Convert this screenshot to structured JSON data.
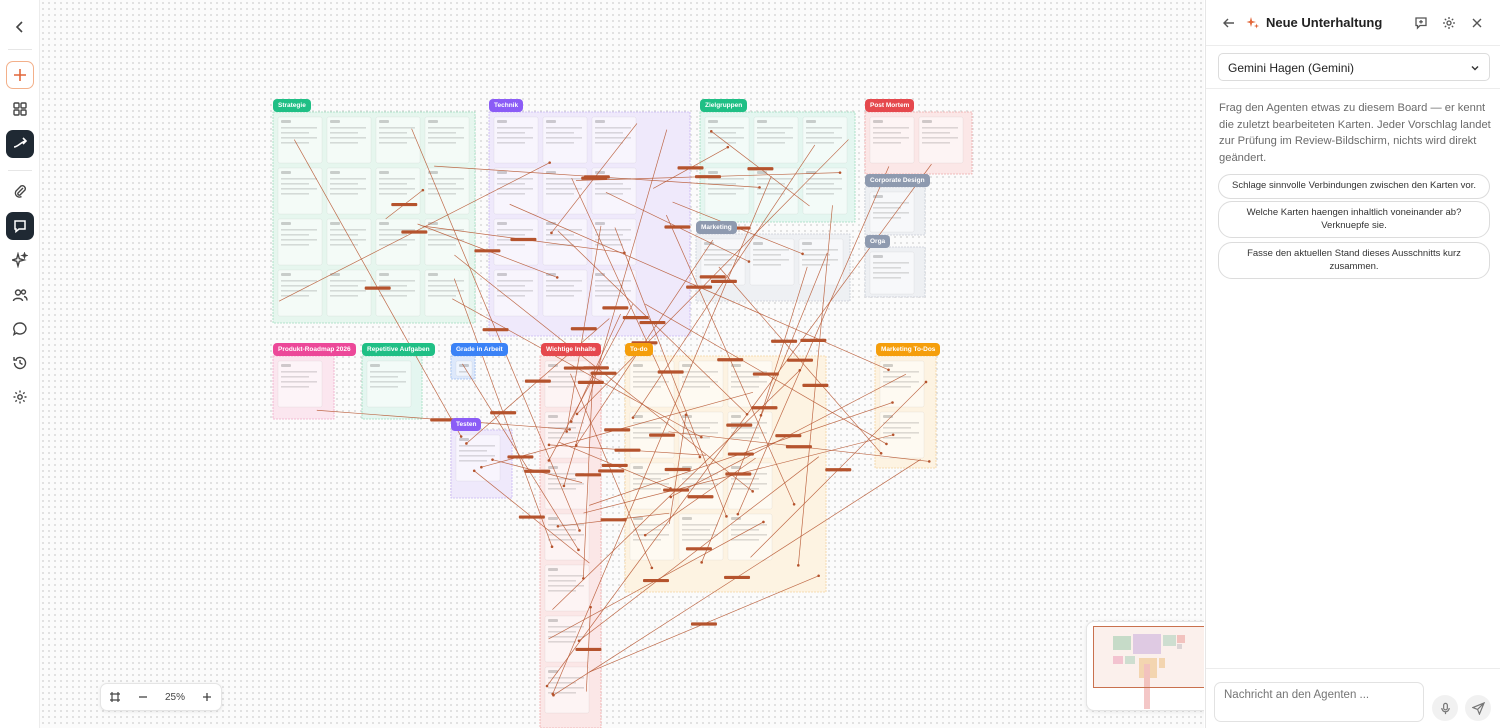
{
  "toolbar": {
    "items": [
      {
        "icon": "chevron-left-icon"
      },
      {
        "icon": "plus-icon"
      },
      {
        "icon": "grid-icon"
      },
      {
        "icon": "connector-icon"
      },
      {
        "icon": "paperclip-icon"
      },
      {
        "icon": "chat-square-icon"
      },
      {
        "icon": "sparkle-icon"
      },
      {
        "icon": "users-icon"
      },
      {
        "icon": "chat-bubble-icon"
      },
      {
        "icon": "history-icon"
      },
      {
        "icon": "gear-icon"
      }
    ]
  },
  "board": {
    "groups": [
      {
        "label": "Strategie",
        "color": "#1fbf85"
      },
      {
        "label": "Technik",
        "color": "#8b5cf6"
      },
      {
        "label": "Zielgruppen",
        "color": "#1fbf85"
      },
      {
        "label": "Post Mortem",
        "color": "#e5484d"
      },
      {
        "label": "Corporate Design",
        "color": "#8e9aaf"
      },
      {
        "label": "Marketing",
        "color": "#8e9aaf"
      },
      {
        "label": "Orga",
        "color": "#8e9aaf"
      },
      {
        "label": "Produkt-Roadmap 2026",
        "color": "#ec4899"
      },
      {
        "label": "Repetitive Aufgaben",
        "color": "#1fbf85"
      },
      {
        "label": "Grade in Arbeit",
        "color": "#3b82f6"
      },
      {
        "label": "Wichtige Inhalte",
        "color": "#e5484d"
      },
      {
        "label": "To-do",
        "color": "#f59e0b"
      },
      {
        "label": "Marketing To-Dos",
        "color": "#f59e0b"
      },
      {
        "label": "Testen",
        "color": "#8b5cf6"
      }
    ],
    "edge_color": "#b5532d"
  },
  "zoom": {
    "value": "25%"
  },
  "panel": {
    "title": "Neue Unterhaltung",
    "model": "Gemini Hagen (Gemini)",
    "intro": "Frag den Agenten etwas zu diesem Board — er kennt die zuletzt bearbeiteten Karten. Jeder Vorschlag landet zur Prüfung im Review-Bildschirm, nichts wird direkt geändert.",
    "suggestions": [
      "Schlage sinnvolle Verbindungen zwischen den Karten vor.",
      "Welche Karten haengen inhaltlich voneinander ab? Verknuepfe sie.",
      "Fasse den aktuellen Stand dieses Ausschnitts kurz zusammen."
    ],
    "input_placeholder": "Nachricht an den Agenten ..."
  }
}
